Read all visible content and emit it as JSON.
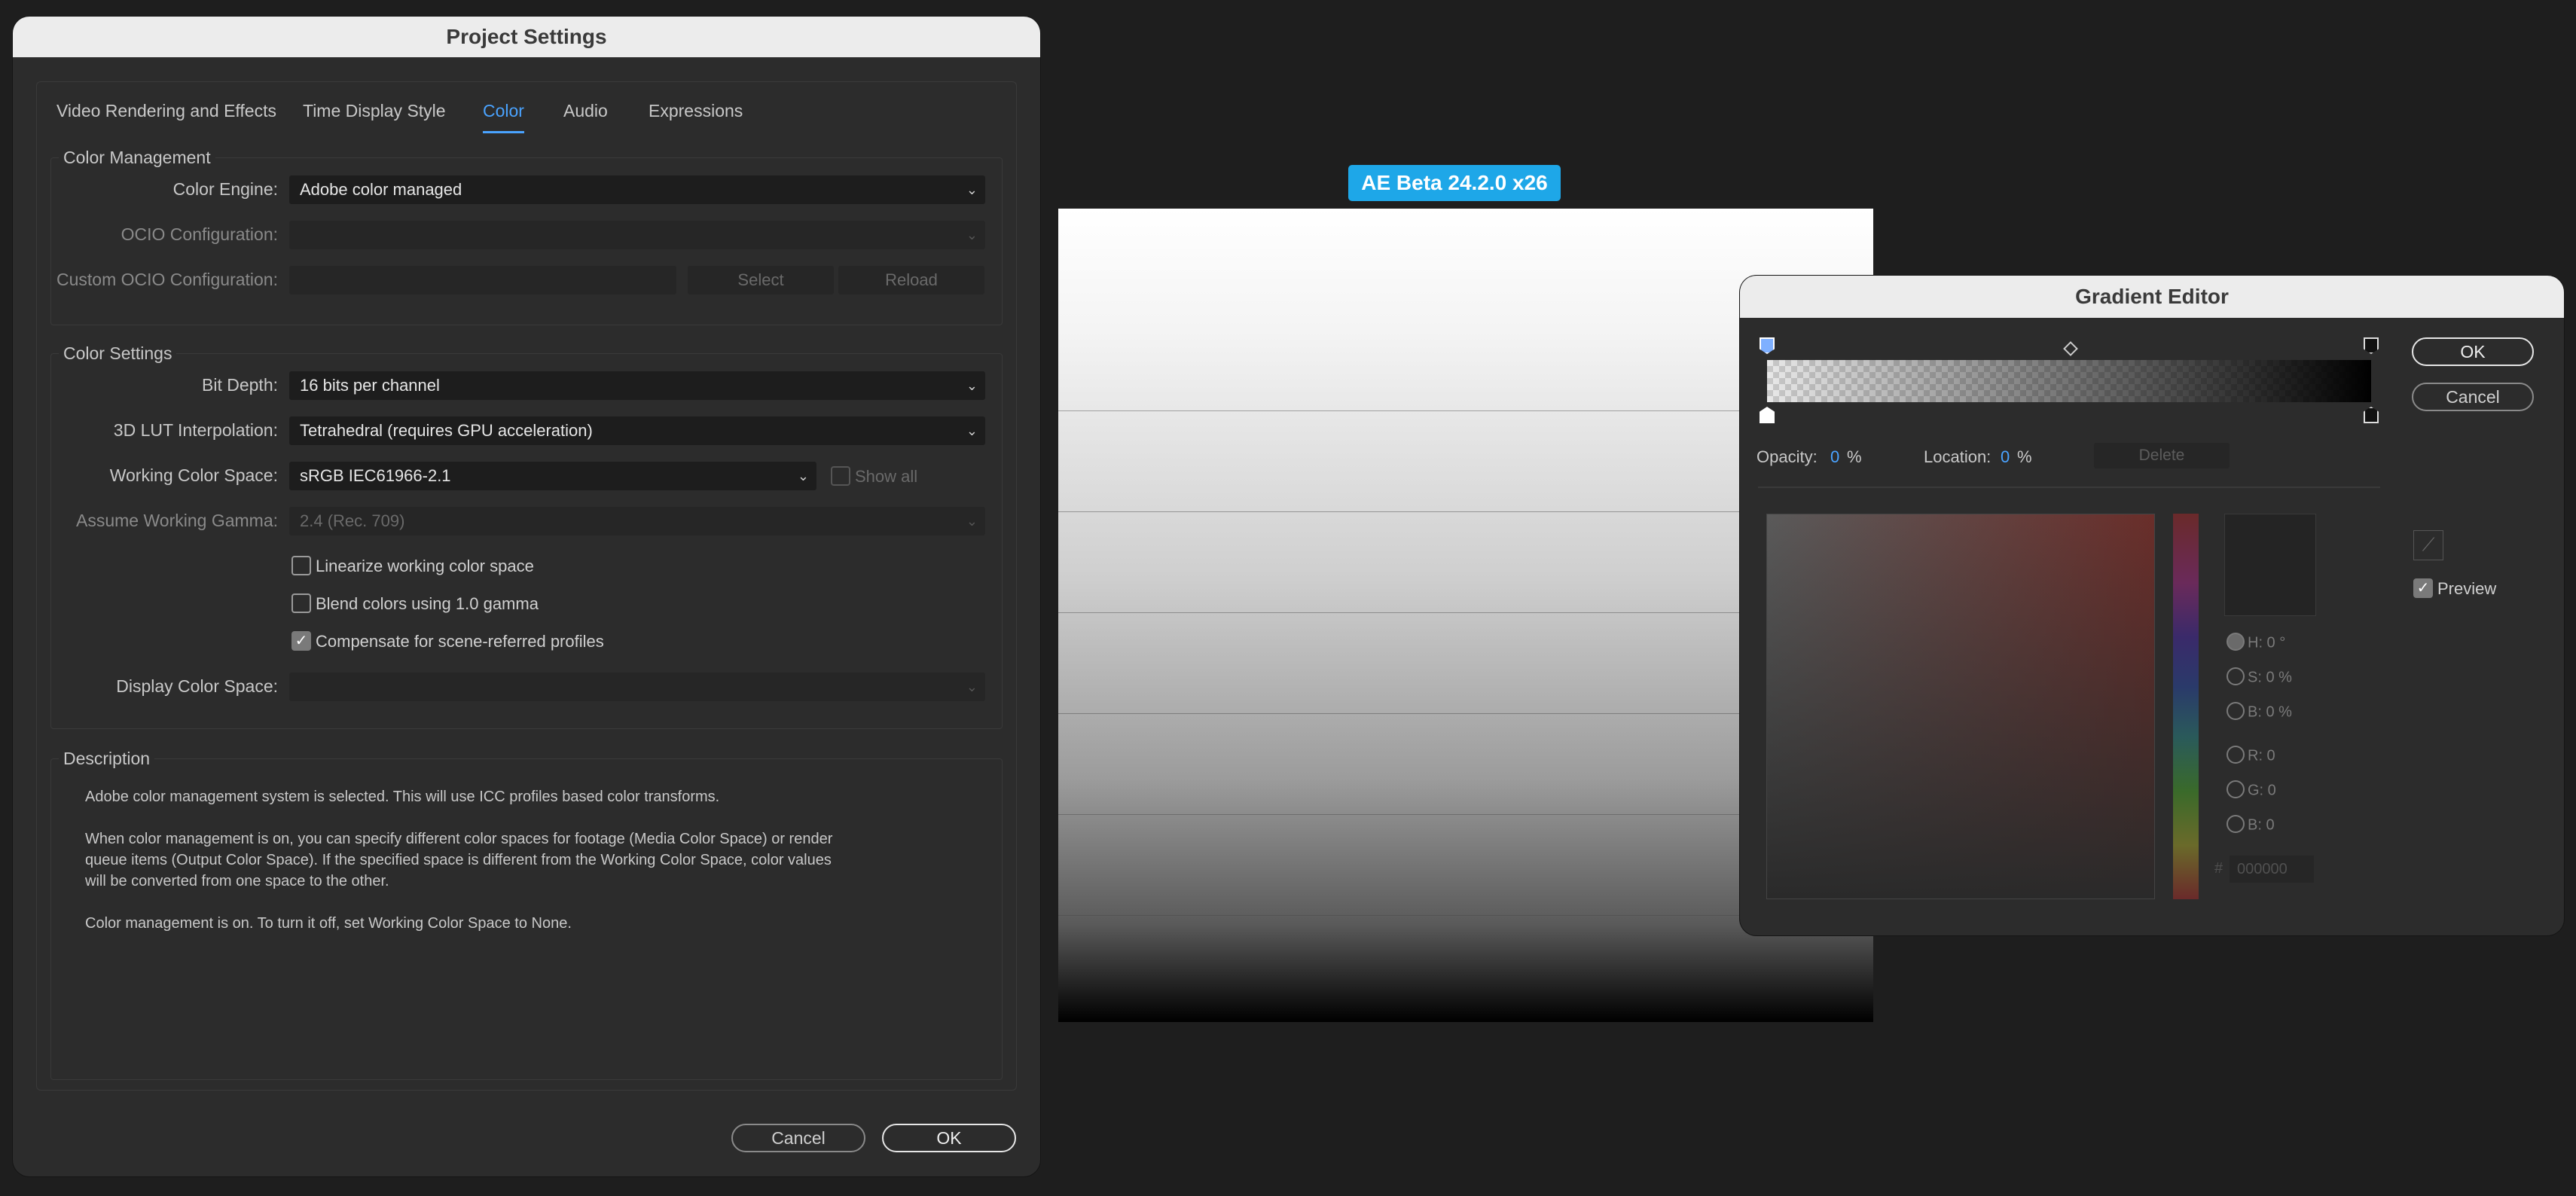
{
  "project_settings": {
    "title": "Project Settings",
    "tabs": [
      {
        "label": "Video Rendering and Effects"
      },
      {
        "label": "Time Display Style"
      },
      {
        "label": "Color"
      },
      {
        "label": "Audio"
      },
      {
        "label": "Expressions"
      }
    ],
    "color_management": {
      "legend": "Color Management",
      "color_engine_label": "Color Engine:",
      "color_engine_value": "Adobe color managed",
      "ocio_label": "OCIO Configuration:",
      "custom_ocio_label": "Custom OCIO Configuration:",
      "select_label": "Select",
      "reload_label": "Reload"
    },
    "color_settings": {
      "legend": "Color Settings",
      "bit_depth_label": "Bit Depth:",
      "bit_depth_value": "16 bits per channel",
      "lut_label": "3D LUT Interpolation:",
      "lut_value": "Tetrahedral (requires GPU acceleration)",
      "working_space_label": "Working Color Space:",
      "working_space_value": "sRGB IEC61966-2.1",
      "show_all_label": "Show all",
      "gamma_label": "Assume Working Gamma:",
      "gamma_value": "2.4 (Rec. 709)",
      "linearize_label": "Linearize working color space",
      "blend_label": "Blend colors using 1.0 gamma",
      "compensate_label": "Compensate for scene-referred profiles",
      "display_space_label": "Display Color Space:"
    },
    "description": {
      "legend": "Description",
      "p1": "Adobe color management system is selected. This will use ICC profiles based color transforms.",
      "p2a": "When color management is on, you can specify different color spaces for footage (Media Color Space) or render",
      "p2b": "queue items (Output Color Space). If the specified space is different from the Working Color Space, color values",
      "p2c": "will be converted from one space to the other.",
      "p3": "Color management is on. To turn it off, set Working Color Space to None."
    },
    "cancel_label": "Cancel",
    "ok_label": "OK"
  },
  "badge": "AE Beta 24.2.0 x26",
  "gradient_editor": {
    "title": "Gradient Editor",
    "ok_label": "OK",
    "cancel_label": "Cancel",
    "opacity_label": "Opacity:",
    "opacity_value": "0",
    "opacity_unit": "%",
    "location_label": "Location:",
    "location_value": "0",
    "location_unit": "%",
    "delete_label": "Delete",
    "h_label": "H: 0 °",
    "s_label": "S: 0 %",
    "b_label": "B: 0 %",
    "r_label": "R: 0",
    "g_label": "G: 0",
    "b2_label": "B: 0",
    "hex_prefix": "#",
    "hex_value": "000000",
    "preview_label": "Preview"
  }
}
